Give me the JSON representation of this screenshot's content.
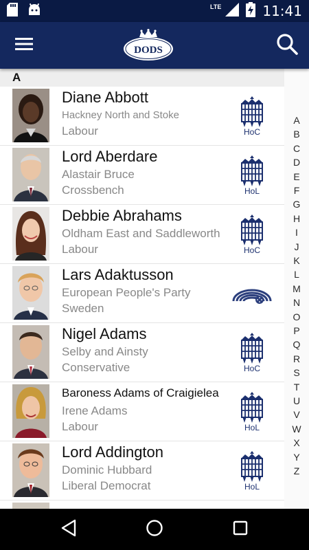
{
  "status_bar": {
    "network": "LTE",
    "time": "11:41"
  },
  "app_bar": {
    "logo_text": "DODS",
    "menu_icon": "hamburger-menu-icon",
    "search_icon": "search-icon"
  },
  "list": {
    "section_letter": "A",
    "items": [
      {
        "name": "Diane Abbott",
        "line1": "Hackney North and Stoke",
        "line2": "Labour",
        "house": "HoC"
      },
      {
        "name": "Lord Aberdare",
        "line1": "Alastair Bruce",
        "line2": "Crossbench",
        "house": "HoL"
      },
      {
        "name": "Debbie Abrahams",
        "line1": "Oldham East and Saddleworth",
        "line2": "Labour",
        "house": "HoC"
      },
      {
        "name": "Lars Adaktusson",
        "line1": "European People's Party",
        "line2": "Sweden",
        "house": ""
      },
      {
        "name": "Nigel Adams",
        "line1": "Selby and Ainsty",
        "line2": "Conservative",
        "house": "HoC"
      },
      {
        "name": "Baroness Adams of Craigielea",
        "line1": "Irene Adams",
        "line2": "Labour",
        "house": "HoL"
      },
      {
        "name": "Lord Addington",
        "line1": "Dominic Hubbard",
        "line2": "Liberal Democrat",
        "house": "HoL"
      }
    ]
  },
  "alphabet": [
    "A",
    "B",
    "C",
    "D",
    "E",
    "F",
    "G",
    "H",
    "I",
    "J",
    "K",
    "L",
    "M",
    "N",
    "O",
    "P",
    "Q",
    "R",
    "S",
    "T",
    "U",
    "V",
    "W",
    "X",
    "Y",
    "Z"
  ],
  "colors": {
    "status_bar": "#0a1a44",
    "app_bar": "#14285e",
    "portcullis": "#1b2f6e",
    "eu_logo": "#2c3f7d",
    "secondary_text": "#888888"
  }
}
